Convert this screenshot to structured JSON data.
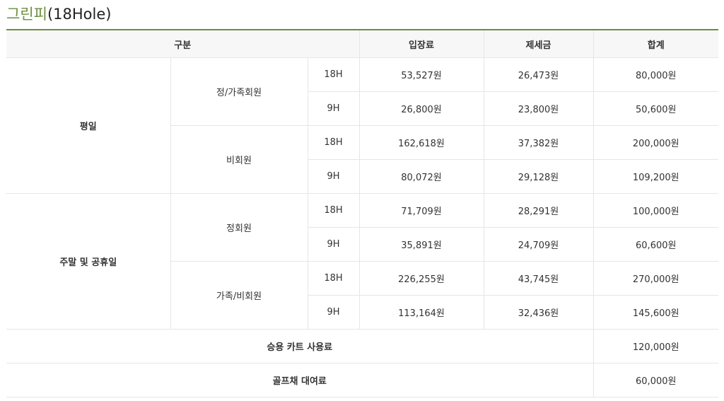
{
  "title": {
    "korean": "그린피",
    "suffix": "(18Hole)"
  },
  "header": {
    "category": "구분",
    "admission": "입장료",
    "tax": "제세금",
    "total": "합계"
  },
  "groups": [
    {
      "day": "평일",
      "types": [
        {
          "name": "정/가족회원",
          "rows": [
            {
              "holes": "18H",
              "admission": "53,527원",
              "tax": "26,473원",
              "total": "80,000원"
            },
            {
              "holes": "9H",
              "admission": "26,800원",
              "tax": "23,800원",
              "total": "50,600원"
            }
          ]
        },
        {
          "name": "비회원",
          "rows": [
            {
              "holes": "18H",
              "admission": "162,618원",
              "tax": "37,382원",
              "total": "200,000원"
            },
            {
              "holes": "9H",
              "admission": "80,072원",
              "tax": "29,128원",
              "total": "109,200원"
            }
          ]
        }
      ]
    },
    {
      "day": "주말 및 공휴일",
      "types": [
        {
          "name": "정회원",
          "rows": [
            {
              "holes": "18H",
              "admission": "71,709원",
              "tax": "28,291원",
              "total": "100,000원"
            },
            {
              "holes": "9H",
              "admission": "35,891원",
              "tax": "24,709원",
              "total": "60,600원"
            }
          ]
        },
        {
          "name": "가족/비회원",
          "rows": [
            {
              "holes": "18H",
              "admission": "226,255원",
              "tax": "43,745원",
              "total": "270,000원"
            },
            {
              "holes": "9H",
              "admission": "113,164원",
              "tax": "32,436원",
              "total": "145,600원"
            }
          ]
        }
      ]
    }
  ],
  "extras": [
    {
      "label": "승용 카트 사용료",
      "total": "120,000원"
    },
    {
      "label": "골프채 대여료",
      "total": "60,000원"
    }
  ]
}
